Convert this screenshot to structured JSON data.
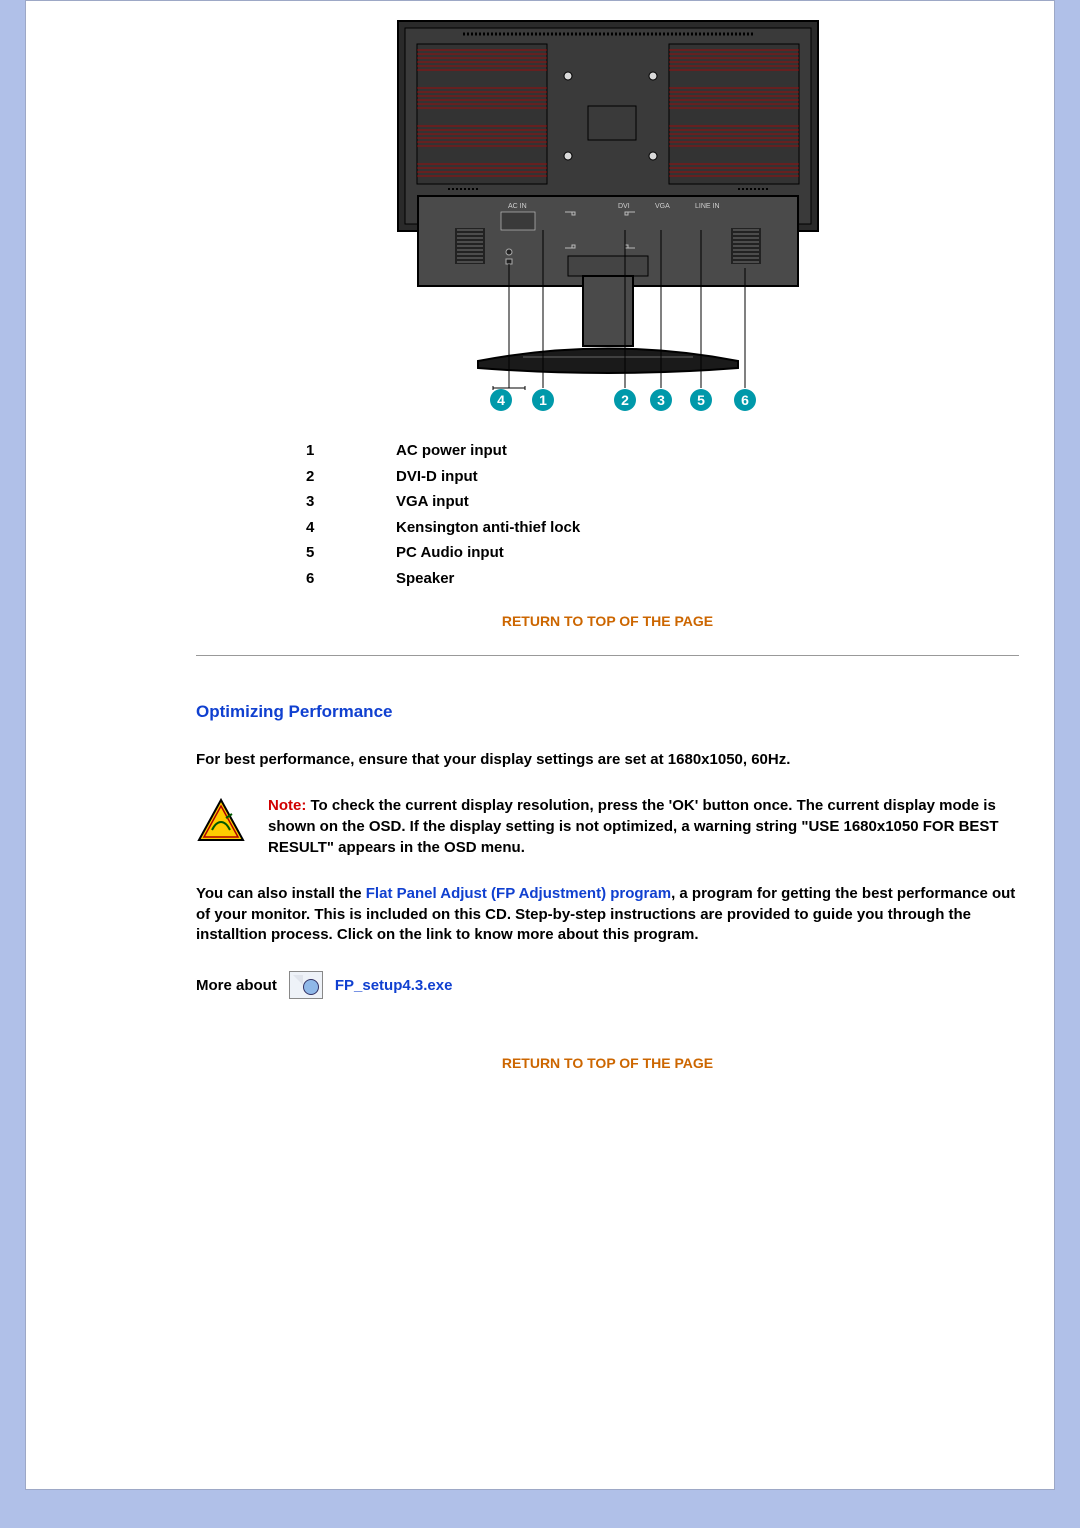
{
  "diagram": {
    "port_labels": {
      "acin": "AC IN",
      "dvi": "DVI",
      "vga": "VGA",
      "linein": "LINE IN"
    },
    "callouts": [
      "4",
      "1",
      "2",
      "3",
      "5",
      "6"
    ]
  },
  "legend": [
    {
      "num": "1",
      "label": "AC power input"
    },
    {
      "num": "2",
      "label": "DVI-D input"
    },
    {
      "num": "3",
      "label": "VGA input"
    },
    {
      "num": "4",
      "label": "Kensington anti-thief lock"
    },
    {
      "num": "5",
      "label": "PC Audio input"
    },
    {
      "num": "6",
      "label": "Speaker"
    }
  ],
  "return_link": "RETURN TO TOP OF THE PAGE",
  "section_title": "Optimizing Performance",
  "perf_text": "For best performance, ensure that your display settings are set at 1680x1050, 60Hz.",
  "note_label": "Note:",
  "note_body": "To check the current display resolution, press the 'OK' button once. The current display mode is shown on the OSD. If the display setting is not optimized, a warning string \"USE 1680x1050 FOR BEST RESULT\" appears in the OSD menu.",
  "install_pre": "You can also install the ",
  "install_link": "Flat Panel Adjust (FP Adjustment) program",
  "install_post": ", a program for getting the best performance out of your monitor. This is included on this CD. Step-by-step instructions are provided to guide you through the installtion process. Click on the link to know more about this program.",
  "more_about_label": "More about",
  "exe_link": "FP_setup4.3.exe"
}
